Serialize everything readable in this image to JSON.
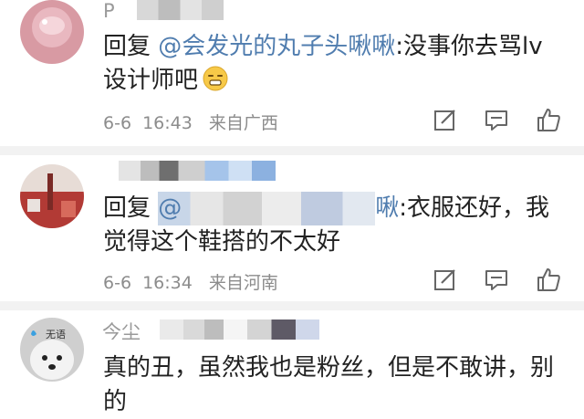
{
  "comments": [
    {
      "username": "P",
      "reply_label": "回复",
      "mention": "@会发光的丸子头啾啾",
      "text": ":没事你去骂lv设计师吧",
      "date": "6-6",
      "time": "16:43",
      "location": "来自广西",
      "emoji": "grimace-emoji"
    },
    {
      "username": "",
      "reply_label": "回复",
      "mention": "@",
      "mention_tail": "啾",
      "text": ":衣服还好，我觉得这个鞋搭的不太好",
      "date": "6-6",
      "time": "16:34",
      "location": "来自河南"
    },
    {
      "username": "今尘",
      "avatar_badge": "无语",
      "text": "真的丑，虽然我也是粉丝，但是不敢讲，别的"
    }
  ],
  "colors": {
    "mention": "#507daf",
    "meta": "#8c8c8c",
    "separator": "#f2f2f2"
  },
  "icons": [
    "edit-icon",
    "comment-icon",
    "like-icon"
  ]
}
